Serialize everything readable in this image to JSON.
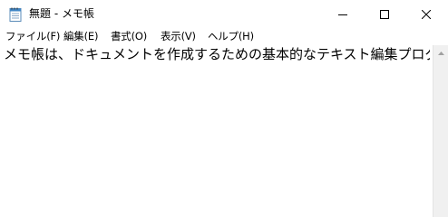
{
  "window": {
    "title": "無題 - メモ帳",
    "app_icon": "notepad-icon",
    "controls": {
      "minimize_icon": "minimize-icon",
      "maximize_icon": "maximize-icon",
      "close_icon": "close-icon"
    }
  },
  "menubar": {
    "items": [
      {
        "label": "ファイル(F)"
      },
      {
        "label": "編集(E)"
      },
      {
        "label": "書式(O)"
      },
      {
        "label": "表示(V)"
      },
      {
        "label": "ヘルプ(H)"
      }
    ]
  },
  "editor": {
    "text": "メモ帳は、ドキュメントを作成するための基本的なテキスト編集プログラムです。"
  },
  "colors": {
    "background": "#ffffff",
    "text": "#000000",
    "scrollbar": "#f0f0f0"
  }
}
